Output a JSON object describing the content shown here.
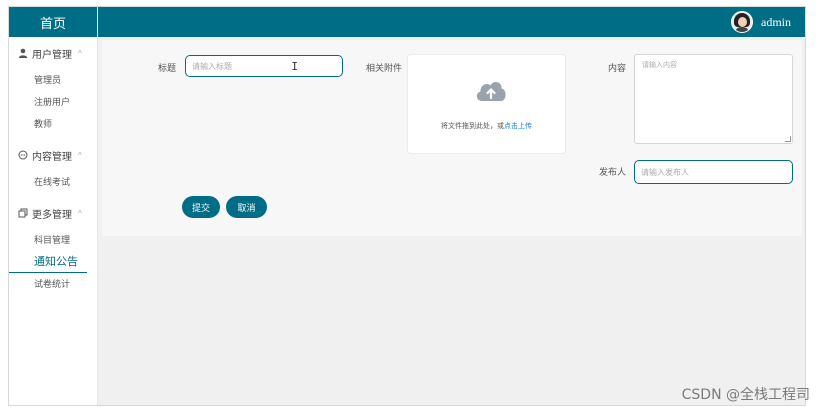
{
  "sidebar": {
    "home_label": "首页",
    "groups": [
      {
        "label": "用户管理",
        "icon": "person-icon",
        "items": [
          "管理员",
          "注册用户",
          "教师"
        ]
      },
      {
        "label": "内容管理",
        "icon": "chat-bubble-icon",
        "items": [
          "在线考试"
        ]
      },
      {
        "label": "更多管理",
        "icon": "copy-icon",
        "items": [
          "科目管理",
          "通知公告",
          "试卷统计"
        ]
      }
    ],
    "active_item": "通知公告"
  },
  "topbar": {
    "username": "admin",
    "color": "#006d86"
  },
  "form": {
    "title_label": "标题",
    "title_placeholder": "请输入标题",
    "attachment_label": "相关附件",
    "upload_hint": "将文件拖到此处，或",
    "upload_link": "点击上传",
    "content_label": "内容",
    "content_placeholder": "请输入内容",
    "publisher_label": "发布人",
    "publisher_placeholder": "请输入发布人",
    "submit_label": "提交",
    "cancel_label": "取消"
  },
  "watermark": "CSDN @全栈工程司"
}
